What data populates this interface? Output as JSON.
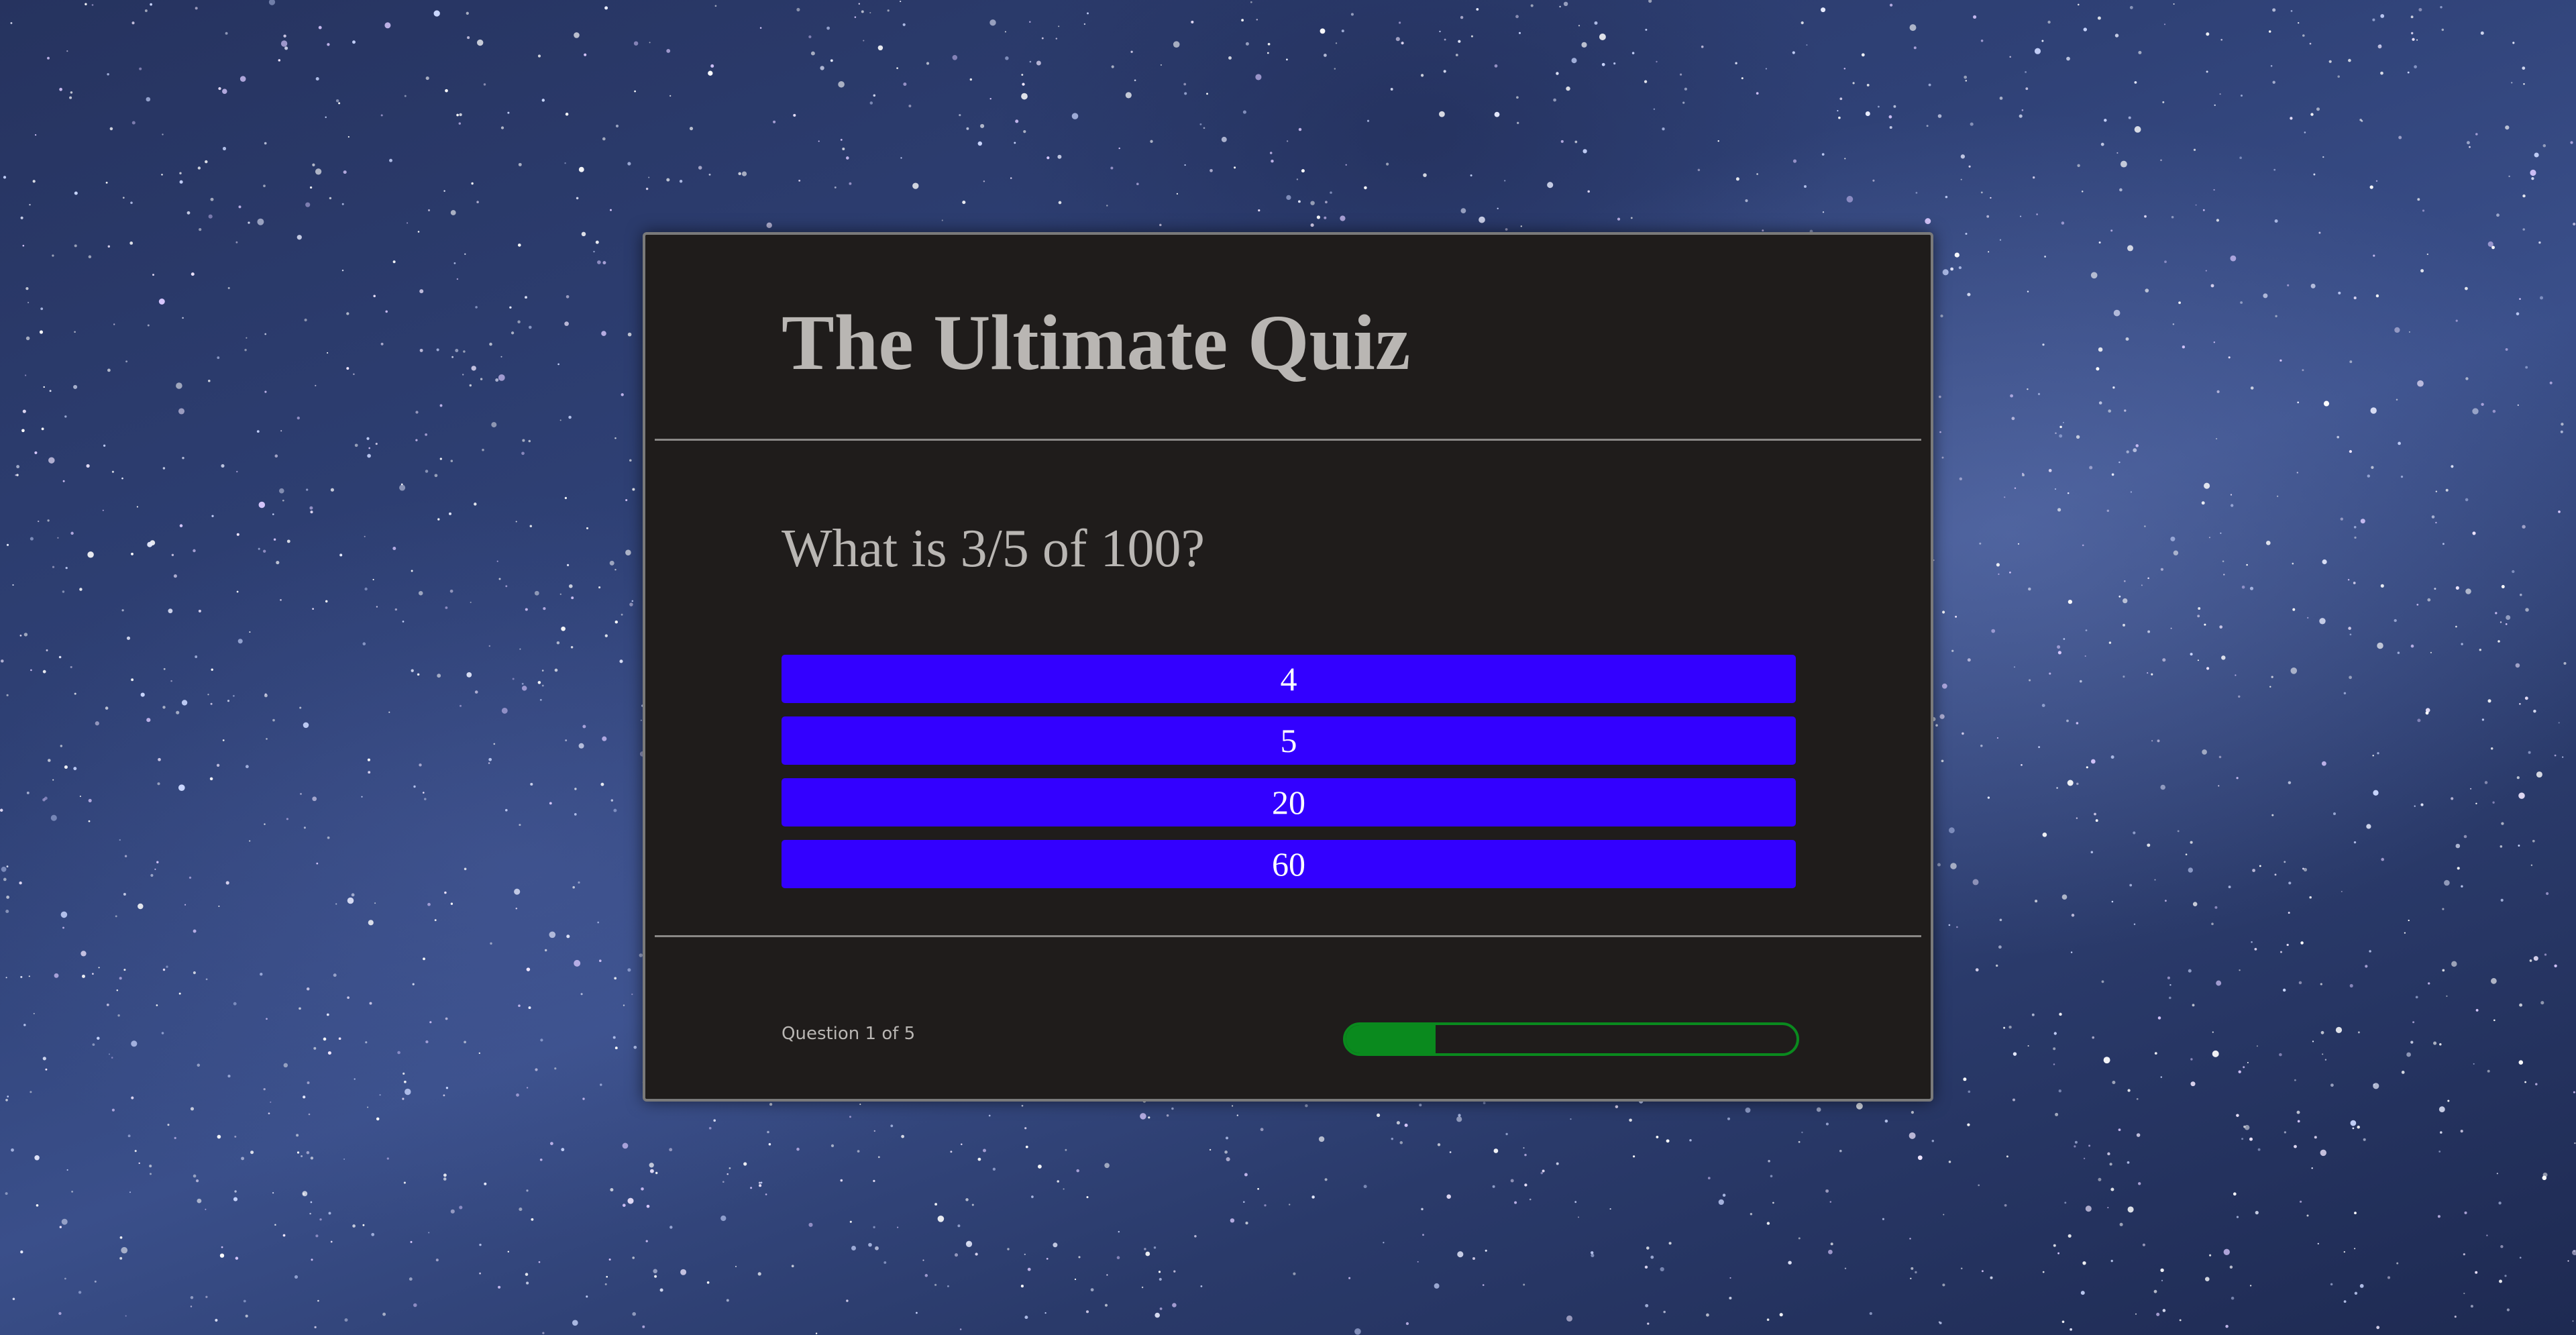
{
  "quiz": {
    "title": "The Ultimate Quiz",
    "question": "What is 3/5 of 100?",
    "answers": [
      {
        "label": "4"
      },
      {
        "label": "5"
      },
      {
        "label": "20"
      },
      {
        "label": "60"
      }
    ],
    "progress_text": "Question 1 of 5",
    "progress_fraction": 0.2
  },
  "colors": {
    "card_background": "#1f1c1b",
    "text": "#b9b6b3",
    "answer_button": "#3300ff",
    "progress": "#0a8a1e"
  }
}
